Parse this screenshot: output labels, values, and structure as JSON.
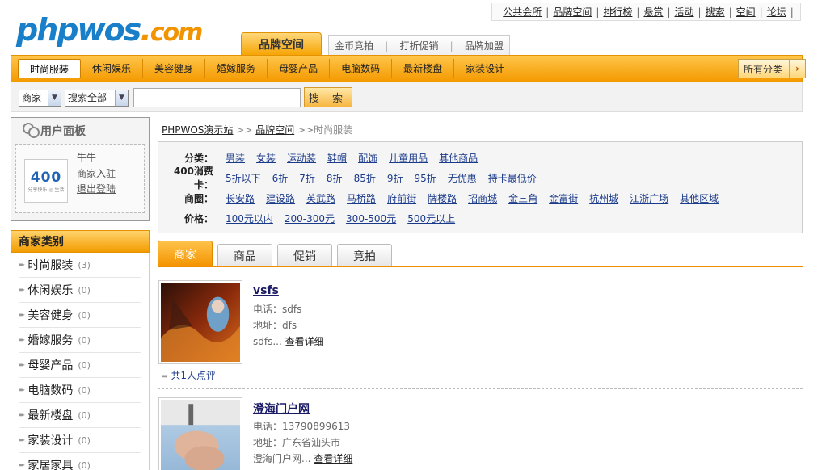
{
  "top_links": [
    "公共会所",
    "品牌空间",
    "排行榜",
    "悬赏",
    "活动",
    "搜索",
    "空间",
    "论坛"
  ],
  "logo": {
    "part1": "php",
    "part2": "wos",
    "dot": ".",
    "part3": "com"
  },
  "main_tab": "品牌空间",
  "sub_tabs": [
    "金币竞拍",
    "打折促销",
    "品牌加盟"
  ],
  "categories": [
    "时尚服装",
    "休闲娱乐",
    "美容健身",
    "婚嫁服务",
    "母婴产品",
    "电脑数码",
    "最新楼盘",
    "家装设计"
  ],
  "all_categories_label": "所有分类",
  "search": {
    "type_value": "商家",
    "scope_value": "搜索全部",
    "keyword": "",
    "button": "搜 索"
  },
  "user_panel": {
    "title": "用户面板",
    "avatar_number": "400",
    "avatar_text": "分享快乐 ◎ 生活",
    "username": "牛牛",
    "merchant_link": "商家入驻",
    "logout": "退出登陆"
  },
  "left_categories": {
    "title": "商家类别",
    "items": [
      {
        "label": "时尚服装",
        "count": "(3)"
      },
      {
        "label": "休闲娱乐",
        "count": "(0)"
      },
      {
        "label": "美容健身",
        "count": "(0)"
      },
      {
        "label": "婚嫁服务",
        "count": "(0)"
      },
      {
        "label": "母婴产品",
        "count": "(0)"
      },
      {
        "label": "电脑数码",
        "count": "(0)"
      },
      {
        "label": "最新楼盘",
        "count": "(0)"
      },
      {
        "label": "家装设计",
        "count": "(0)"
      },
      {
        "label": "家居家具",
        "count": "(0)"
      }
    ]
  },
  "breadcrumb": {
    "home": "PHPWOS演示站",
    "sep": ">>",
    "section": "品牌空间",
    "current": "时尚服装"
  },
  "filters": {
    "category": {
      "label": "分类：",
      "items": [
        "男装",
        "女装",
        "运动装",
        "鞋帽",
        "配饰",
        "儿童用品",
        "其他商品"
      ]
    },
    "discount": {
      "label": "400消费卡：",
      "items": [
        "5折以下",
        "6折",
        "7折",
        "8折",
        "85折",
        "9折",
        "95折",
        "无优惠",
        "持卡最低价"
      ]
    },
    "area": {
      "label": "商圈：",
      "items": [
        "长安路",
        "建设路",
        "英武路",
        "马桥路",
        "府前街",
        "牌楼路",
        "招商城",
        "金三角",
        "金富街",
        "杭州城",
        "江浙广场",
        "其他区域"
      ]
    },
    "price": {
      "label": "价格：",
      "items": [
        "100元以内",
        "200-300元",
        "300-500元",
        "500元以上"
      ]
    }
  },
  "content_tabs": [
    "商家",
    "商品",
    "促销",
    "竞拍"
  ],
  "listings": [
    {
      "title": "vsfs",
      "phone_label": "电话：",
      "phone": "sdfs",
      "addr_label": "地址：",
      "addr": "dfs",
      "desc": "sdfs...",
      "detail": "查看详细",
      "reviews": "共1人点评"
    },
    {
      "title": "澄海门户网",
      "phone_label": "电话：",
      "phone": "13790899613",
      "addr_label": "地址：",
      "addr": "广东省汕头市",
      "desc": "澄海门户网...",
      "detail": "查看详细"
    }
  ],
  "colors": {
    "accent": "#f39c00",
    "link": "#1a3a8a",
    "logo_blue": "#1a7fc9"
  }
}
